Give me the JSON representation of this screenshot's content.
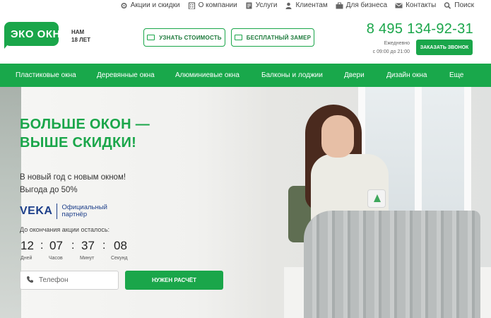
{
  "topbar": {
    "links": [
      {
        "label": "Акции и скидки",
        "icon": "gear-icon"
      },
      {
        "label": "О компании",
        "icon": "building-icon"
      },
      {
        "label": "Услуги",
        "icon": "document-icon"
      },
      {
        "label": "Клиентам",
        "icon": "person-icon"
      },
      {
        "label": "Для бизнеса",
        "icon": "briefcase-icon"
      },
      {
        "label": "Контакты",
        "icon": "envelope-icon"
      },
      {
        "label": "Поиск",
        "icon": "search-icon"
      }
    ]
  },
  "header": {
    "logo_text": "ЭКО ОКНА",
    "years_line1": "НАМ",
    "years_line2": "18 ЛЕТ",
    "btn_cost": "УЗНАТЬ СТОИМОСТЬ",
    "btn_measure": "БЕСПЛАТНЫЙ ЗАМЕР",
    "phone": "8 495 134-92-31",
    "hours_line1": "Ежедневно",
    "hours_line2": "с 09:00 до 21:00",
    "btn_call": "ЗАКАЗАТЬ ЗВОНОК"
  },
  "nav": {
    "items": [
      "Пластиковые окна",
      "Деревянные окна",
      "Алюминиевые окна",
      "Балконы и лоджии",
      "Двери",
      "Дизайн окна",
      "Еще"
    ]
  },
  "hero": {
    "title_line1": "БОЛЬШЕ ОКОН —",
    "title_line2": "ВЫШЕ СКИДКИ!",
    "sub_line1": "В новый год с новым окном!",
    "sub_line2": "Выгода до 50%",
    "veka_logo": "VEKA",
    "veka_text_line1": "Официальный",
    "veka_text_line2": "партнёр",
    "countdown_label": "До окончания акции осталось:",
    "countdown": {
      "days": "12",
      "hours": "07",
      "minutes": "37",
      "seconds": "08",
      "days_label": "Дней",
      "hours_label": "Часов",
      "minutes_label": "Минут",
      "seconds_label": "Секунд"
    },
    "phone_placeholder": "Телефон",
    "btn_calc": "НУЖЕН РАСЧЁТ"
  },
  "colors": {
    "accent": "#1aa64a",
    "veka": "#1d3f8a"
  }
}
